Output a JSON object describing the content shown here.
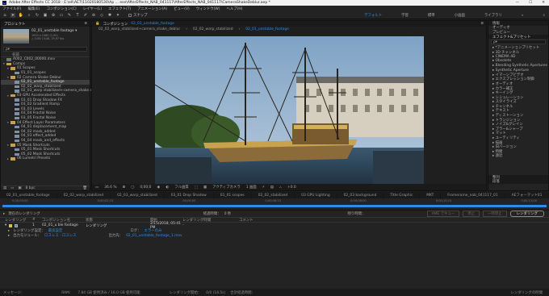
{
  "title": "Adobe After Effects CC 2018 - E:\\ell\\AE7\\11020180530\\Ap ... ese\\AfterEffects_NAB_041117\\AfterEffects_NAB_041117\\CameraShakeDeblur.aep *",
  "menu": [
    "ファイル(F)",
    "編集(E)",
    "コンポジション(C)",
    "レイヤー(L)",
    "エフェクト(T)",
    "アニメーション(A)",
    "ビュー(V)",
    "ウィンドウ(W)",
    "ヘルプ(H)"
  ],
  "toolbar": {
    "snap": "スナップ"
  },
  "workspaces": [
    "デフォルト",
    "学習",
    "標準",
    "小画面",
    "ライブラリ"
  ],
  "project": {
    "title": "プロジェクト",
    "comp_name": "02_01_unstable footage ▾",
    "comp_meta": "1920 x 1080 (1,00)\n△ 0;00;13;06, 29,97 fps",
    "search": "ρ▾",
    "col_name": "名前"
  },
  "tree": [
    {
      "ind": 0,
      "t": "file",
      "label": "A002_C002_00000.mxv"
    },
    {
      "ind": 0,
      "t": "folder",
      "label": "Comps",
      "open": true
    },
    {
      "ind": 1,
      "t": "folder",
      "label": "01 Scopes",
      "open": true
    },
    {
      "ind": 2,
      "t": "comp",
      "label": "01_01_scopes"
    },
    {
      "ind": 1,
      "t": "folder",
      "label": "02 Camera Shake Deblur",
      "open": true
    },
    {
      "ind": 2,
      "t": "comp",
      "label": "02_01_unstable_footage",
      "sel": true
    },
    {
      "ind": 2,
      "t": "comp",
      "label": "02_02_warp_stabilized"
    },
    {
      "ind": 2,
      "t": "comp",
      "label": "02_03_warp stabilized+camera_shake deblur"
    },
    {
      "ind": 1,
      "t": "folder",
      "label": "03 GPU Accelerated Effects",
      "open": true
    },
    {
      "ind": 2,
      "t": "comp",
      "label": "03_01 Drop Shadow FX"
    },
    {
      "ind": 2,
      "t": "comp",
      "label": "03_02 Gradient Ramp"
    },
    {
      "ind": 2,
      "t": "comp",
      "label": "03_03 Levels"
    },
    {
      "ind": 2,
      "t": "comp",
      "label": "03_04 Fractal Noise"
    },
    {
      "ind": 2,
      "t": "comp",
      "label": "03_05 Fractal Noise"
    },
    {
      "ind": 1,
      "t": "folder",
      "label": "04 Effect Layer Parameters",
      "open": true
    },
    {
      "ind": 2,
      "t": "comp",
      "label": "04_01 displacement_map"
    },
    {
      "ind": 2,
      "t": "comp",
      "label": "04_02 mask_added"
    },
    {
      "ind": 2,
      "t": "comp",
      "label": "04_03 effect_added"
    },
    {
      "ind": 2,
      "t": "comp",
      "label": "04_04 mask_and_effects"
    },
    {
      "ind": 1,
      "t": "folder",
      "label": "05 Mask Shortcuts",
      "open": true
    },
    {
      "ind": 2,
      "t": "comp",
      "label": "05_01 Mask Shortcuts"
    },
    {
      "ind": 2,
      "t": "comp",
      "label": "05_02 Mask Shortcuts"
    },
    {
      "ind": 1,
      "t": "folder",
      "label": "06 Lumetri Presets",
      "open": false
    }
  ],
  "project_footer": "8 bpc",
  "comp_viewer": {
    "panel": "コンポジション",
    "active_comp": "02_01_unstable_footage",
    "tabs": [
      "02_02_warp_stabilized+camera_shake_deblur",
      "02_02_warp_stabilized",
      "02_01_unstable_footage"
    ],
    "zoom": "36.6 %",
    "timecode": "0;00;0",
    "quality": "フル画質",
    "camera": "アクティブカメラ",
    "views": "1 画面",
    "exposure": "+0.0"
  },
  "right_panel": {
    "header": "情報",
    "items": [
      "オーディオ",
      "プレビュー",
      "エフェクト&プリセット"
    ],
    "search": "ρ▾",
    "effects": [
      "▸ *アニメーションプリセット",
      "▸ 3D チャンネル",
      "▸ CINEMA 4D",
      "▸ Obsolete",
      "▸ Blending Synthetic Apertures",
      "▸ Synthetic Aperture",
      "▸ イマーシブビデオ",
      "▸ エクスプレッション制御",
      "▸ オーディオ",
      "▸ カラー補正",
      "▸ キーイング",
      "▸ シミュレーション",
      "▸ スタイライズ",
      "▸ チャンネル",
      "▸ テキスト",
      "▸ ディストーション",
      "▸ トランジション",
      "▸ ノイズ&グレイン",
      "▸ ブラー&シャープ",
      "▸ マット",
      "▸ ユーティリティ",
      "▸ 描画",
      "▸ 旧バージョン",
      "▸ 時間",
      "▸ 遠近"
    ],
    "bottom": [
      "整列",
      "段落"
    ]
  },
  "timeline_tabs": [
    "02_01_unstable_footage",
    "02_02_warp_stabilized",
    "02_03_warp_stabilized",
    "03_01 Drop Shadow",
    "01_01 scopes",
    "02_02_stabilized",
    "03 GPU Lighting",
    "02_03 background",
    "Title Graphic",
    "MKT",
    "Framerame_nab_041117_01",
    "AEフォーマット01",
    "レンダーキュー"
  ],
  "timecode_bar": [
    "0;00;00;00",
    "0;00;02;15",
    "00;04;00",
    "0;00;06;15",
    "0;00;08;00",
    "0;00;10;15",
    "0;00;13;00"
  ],
  "render_queue": {
    "current": "現在のレンダリング",
    "elapsed": "経過時間：",
    "elapsed_val": "0 秒",
    "remaining": "残り時間：",
    "queue_ame": "AME でキュー",
    "stop": "停止",
    "pause": "一時停止",
    "render": "レンダリング",
    "columns": [
      "レンダリング",
      "#",
      "コンポジション名",
      "状態",
      "開始",
      "レンダリング時間",
      "コメント"
    ],
    "row": {
      "num": "1",
      "comp": "02_01_u ble footage",
      "status": "レンダリング",
      "start": "2/15/2018, 05:41 PM",
      "time": "-"
    },
    "settings_label": "レンダリング設定：",
    "settings_val": "最良設定",
    "log_label": "ログ：",
    "log_val": "エラーのみ",
    "module_label": "出力モジュール：",
    "module_val": "ロスレス - ロスレス",
    "output_label": "出力先：",
    "output_val": "02_01_unstable_footage_1.mov"
  },
  "status": {
    "msg": "メッセージ：",
    "ram": "RAM：",
    "ram_val": "7.84 GB 使用済み / 16.0 GB 使用可能",
    "renders": "レンダリング開始：",
    "renders_val": "0/0 (18.5s)",
    "total": "合計経過時間：",
    "render_time": "レンダリングの時間"
  }
}
